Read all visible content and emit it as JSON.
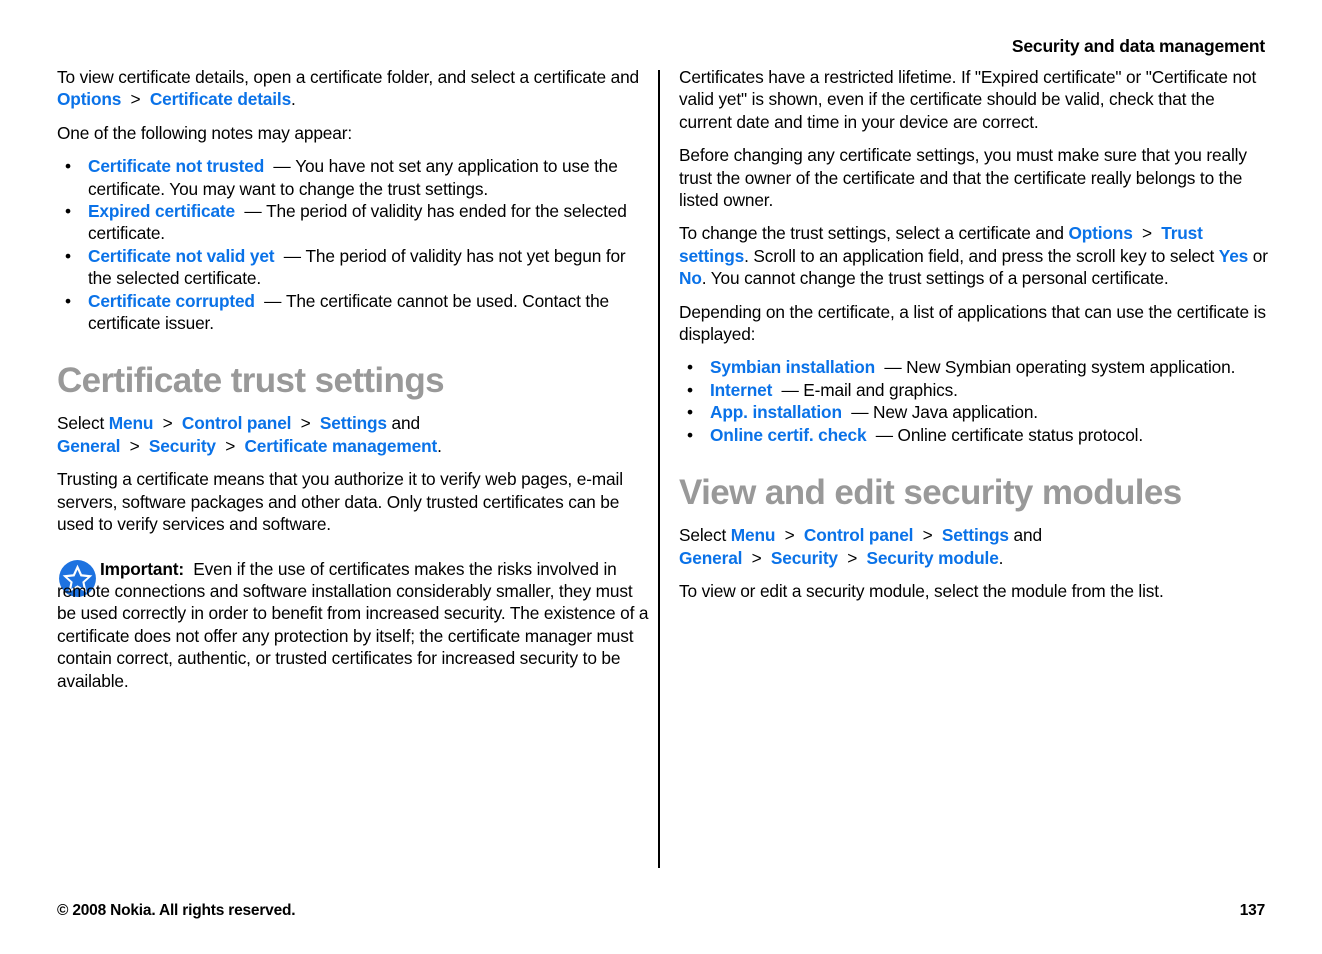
{
  "colors": {
    "link_blue": "#0a72e8",
    "heading_gray": "#999999",
    "text_black": "#000000",
    "page_background": "#ffffff",
    "star_icon_blue": "#1d72e0"
  },
  "header": {
    "running_title": "Security and data management"
  },
  "left_column": {
    "intro_paragraph": {
      "part1": "To view certificate details, open a certificate folder, and select a certificate and ",
      "link1": "Options",
      "sep1": ">",
      "link2": "Certificate details",
      "part2": "."
    },
    "notes_lead": "One of the following notes may appear:",
    "note_bullets": [
      {
        "term": "Certificate not trusted",
        "dash": "—",
        "description": "You have not set any application to use the certificate. You may want to change the trust settings."
      },
      {
        "term": "Expired certificate",
        "dash": "—",
        "description": "The period of validity has ended for the selected certificate."
      },
      {
        "term": "Certificate not valid yet",
        "dash": "—",
        "description": "The period of validity has not yet begun for the selected certificate."
      },
      {
        "term": "Certificate corrupted",
        "dash": "—",
        "description": "The certificate cannot be used. Contact the certificate issuer."
      }
    ],
    "section_heading": "Certificate trust settings",
    "select_path": {
      "lead": "Select ",
      "item1": "Menu",
      "sep1": ">",
      "item2": "Control panel",
      "sep2": ">",
      "item3": "Settings",
      "conjunction": " and ",
      "item4": "General",
      "sep3": ">",
      "item5": "Security",
      "sep4": ">",
      "item6": "Certificate management",
      "period": "."
    },
    "trusting_paragraph": "Trusting a certificate means that you authorize it to verify web pages, e-mail servers, software packages and other data. Only trusted certificates can be used to verify services and software.",
    "important_note": {
      "icon": "star-in-circle-icon",
      "label": "Important:",
      "text": "Even if the use of certificates makes the risks involved in remote connections and software installation considerably smaller, they must be used correctly in order to benefit from increased security. The existence of a certificate does not offer any protection by itself; the certificate manager must contain correct, authentic, or trusted certificates for increased security to be available."
    }
  },
  "right_column": {
    "lifetime_paragraph": "Certificates have a restricted lifetime. If \"Expired certificate\" or \"Certificate not valid yet\" is shown, even if the certificate should be valid, check that the current date and time in your device are correct.",
    "trust_owner_paragraph": "Before changing any certificate settings, you must make sure that you really trust the owner of the certificate and that the certificate really belongs to the listed owner.",
    "change_trust_paragraph": {
      "part1": "To change the trust settings, select a certificate and ",
      "link1": "Options",
      "sep1": ">",
      "link2": "Trust settings",
      "part2": ". Scroll to an application field, and press the scroll key to select ",
      "link3": "Yes",
      "part3": " or ",
      "link4": "No",
      "part4": ". You cannot change the trust settings of a personal certificate."
    },
    "depending_lead": "Depending on the certificate, a list of applications that can use the certificate is displayed:",
    "application_bullets": [
      {
        "term": "Symbian installation",
        "dash": "—",
        "description": "New Symbian operating system application."
      },
      {
        "term": "Internet",
        "dash": "—",
        "description": "E-mail and graphics."
      },
      {
        "term": "App. installation",
        "dash": "—",
        "description": "New Java application."
      },
      {
        "term": "Online certif. check",
        "dash": "—",
        "description": "Online certificate status protocol."
      }
    ],
    "section_heading": "View and edit security modules",
    "select_path": {
      "lead": "Select ",
      "item1": "Menu",
      "sep1": ">",
      "item2": "Control panel",
      "sep2": ">",
      "item3": "Settings",
      "conjunction": " and ",
      "item4": "General",
      "sep3": ">",
      "item5": "Security",
      "sep4": ">",
      "item6": "Security module",
      "period": "."
    },
    "closing_paragraph": "To view or edit a security module, select the module from the list."
  },
  "footer": {
    "copyright": "© 2008 Nokia. All rights reserved.",
    "page_number": "137"
  }
}
